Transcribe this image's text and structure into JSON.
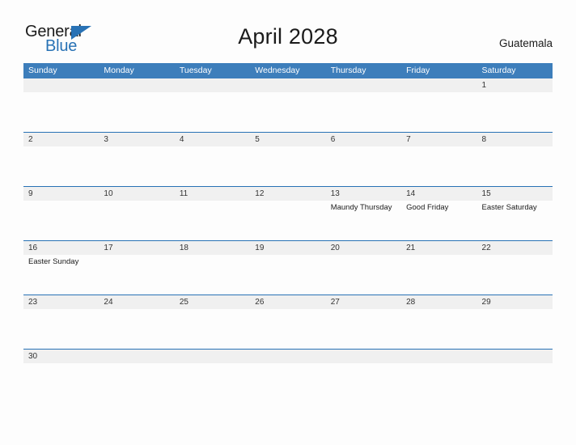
{
  "logo": {
    "word_one": "General",
    "word_two": "Blue",
    "triangle_icon": "triangle-icon",
    "accent_color": "#2872b5"
  },
  "header": {
    "title": "April 2028",
    "country": "Guatemala"
  },
  "calendar": {
    "header_color": "#3d7ebb",
    "separator_color": "#2872b5",
    "daynum_band_color": "#f0f0f0",
    "weekdays": [
      "Sunday",
      "Monday",
      "Tuesday",
      "Wednesday",
      "Thursday",
      "Friday",
      "Saturday"
    ],
    "weeks": [
      {
        "days": [
          {
            "num": "",
            "event": ""
          },
          {
            "num": "",
            "event": ""
          },
          {
            "num": "",
            "event": ""
          },
          {
            "num": "",
            "event": ""
          },
          {
            "num": "",
            "event": ""
          },
          {
            "num": "",
            "event": ""
          },
          {
            "num": "1",
            "event": ""
          }
        ]
      },
      {
        "days": [
          {
            "num": "2",
            "event": ""
          },
          {
            "num": "3",
            "event": ""
          },
          {
            "num": "4",
            "event": ""
          },
          {
            "num": "5",
            "event": ""
          },
          {
            "num": "6",
            "event": ""
          },
          {
            "num": "7",
            "event": ""
          },
          {
            "num": "8",
            "event": ""
          }
        ]
      },
      {
        "days": [
          {
            "num": "9",
            "event": ""
          },
          {
            "num": "10",
            "event": ""
          },
          {
            "num": "11",
            "event": ""
          },
          {
            "num": "12",
            "event": ""
          },
          {
            "num": "13",
            "event": "Maundy Thursday"
          },
          {
            "num": "14",
            "event": "Good Friday"
          },
          {
            "num": "15",
            "event": "Easter Saturday"
          }
        ]
      },
      {
        "days": [
          {
            "num": "16",
            "event": "Easter Sunday"
          },
          {
            "num": "17",
            "event": ""
          },
          {
            "num": "18",
            "event": ""
          },
          {
            "num": "19",
            "event": ""
          },
          {
            "num": "20",
            "event": ""
          },
          {
            "num": "21",
            "event": ""
          },
          {
            "num": "22",
            "event": ""
          }
        ]
      },
      {
        "days": [
          {
            "num": "23",
            "event": ""
          },
          {
            "num": "24",
            "event": ""
          },
          {
            "num": "25",
            "event": ""
          },
          {
            "num": "26",
            "event": ""
          },
          {
            "num": "27",
            "event": ""
          },
          {
            "num": "28",
            "event": ""
          },
          {
            "num": "29",
            "event": ""
          }
        ]
      },
      {
        "days": [
          {
            "num": "30",
            "event": ""
          },
          {
            "num": "",
            "event": ""
          },
          {
            "num": "",
            "event": ""
          },
          {
            "num": "",
            "event": ""
          },
          {
            "num": "",
            "event": ""
          },
          {
            "num": "",
            "event": ""
          },
          {
            "num": "",
            "event": ""
          }
        ]
      }
    ]
  }
}
